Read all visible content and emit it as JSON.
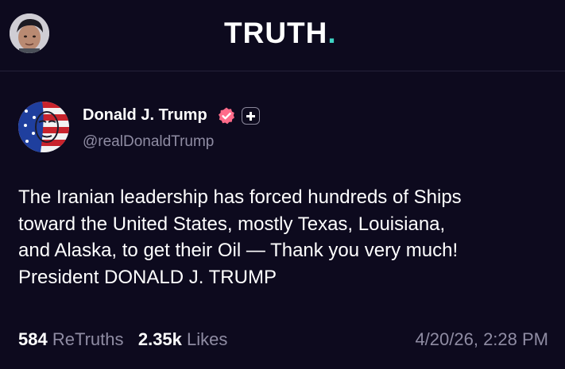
{
  "header": {
    "logo_text": "TRUTH",
    "logo_dot": ".",
    "accent_color": "#3fd3c4"
  },
  "post": {
    "author_name": "Donald J. Trump",
    "handle": "@realDonaldTrump",
    "verified_icon": "verified-badge-icon",
    "verified_color": "#ff6b8a",
    "follow_icon": "plus-icon",
    "text": "The Iranian leadership has forced hundreds of Ships\ntoward the United States, mostly Texas, Louisiana,\nand Alaska, to get their Oil — Thank you very much!\nPresident DONALD J. TRUMP",
    "retruths_count": "584",
    "retruths_label": "ReTruths",
    "likes_count": "2.35k",
    "likes_label": "Likes",
    "timestamp": "4/20/26, 2:28 PM"
  }
}
